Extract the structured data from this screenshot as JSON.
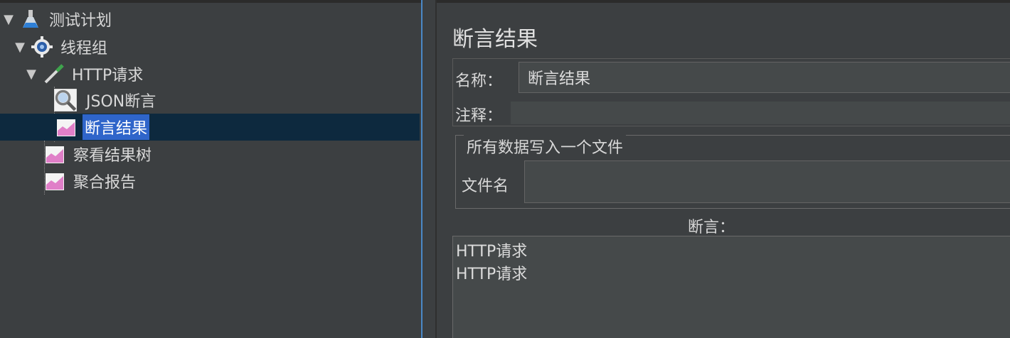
{
  "tree": {
    "items": [
      {
        "label": "测试计划",
        "icon": "flask-icon",
        "expanded": true,
        "level": 0
      },
      {
        "label": "线程组",
        "icon": "gear-icon",
        "expanded": true,
        "level": 1
      },
      {
        "label": "HTTP请求",
        "icon": "pipette-icon",
        "expanded": true,
        "level": 2
      },
      {
        "label": "JSON断言",
        "icon": "magnifier-icon",
        "level": 3
      },
      {
        "label": "断言结果",
        "icon": "chart-icon",
        "level": 3,
        "selected": true
      },
      {
        "label": "察看结果树",
        "icon": "chart-icon",
        "level": 2
      },
      {
        "label": "聚合报告",
        "icon": "chart-icon",
        "level": 2
      }
    ]
  },
  "panel": {
    "title": "断言结果",
    "name_label": "名称：",
    "name_value": "断言结果",
    "comment_label": "注释：",
    "file_group_title": "所有数据写入一个文件",
    "filename_label": "文件名",
    "filename_value": "",
    "assertions_label": "断言：",
    "assertions": [
      "HTTP请求",
      "HTTP请求"
    ]
  },
  "colors": {
    "background": "#3c3f41",
    "selection": "#2f65ca",
    "selection_row": "#0d293e",
    "focus_border": "#4a88c7"
  }
}
